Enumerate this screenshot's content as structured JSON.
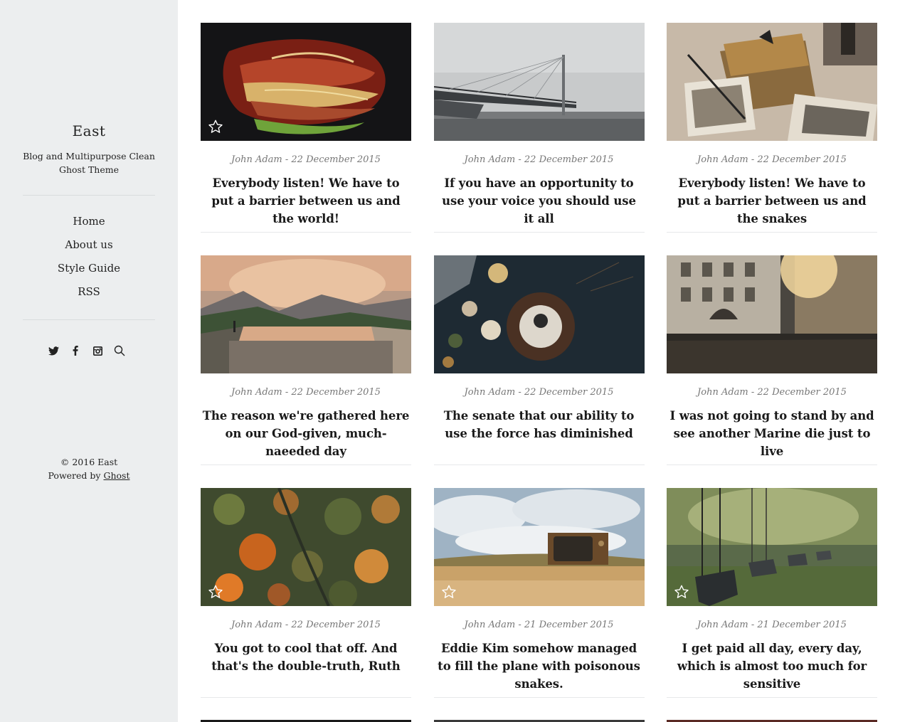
{
  "site": {
    "title": "East",
    "description": "Blog and Multipurpose Clean Ghost Theme"
  },
  "nav": [
    {
      "label": "Home"
    },
    {
      "label": "About us"
    },
    {
      "label": "Style Guide"
    },
    {
      "label": "RSS"
    }
  ],
  "social": [
    "twitter-icon",
    "facebook-icon",
    "instagram-icon",
    "search-icon"
  ],
  "footer": {
    "copyright": "© 2016 East",
    "powered_prefix": "Powered by",
    "powered_link": "Ghost"
  },
  "posts": [
    {
      "meta": "John Adam - 22 December 2015",
      "title": "Everybody listen! We have to put a barrier between us and the world!",
      "featured": true,
      "image": "autumn-leaves"
    },
    {
      "meta": "John Adam - 22 December 2015",
      "title": "If you have an opportunity to use your voice you should use it all",
      "featured": false,
      "image": "foggy-bridge"
    },
    {
      "meta": "John Adam - 22 December 2015",
      "title": "Everybody listen! We have to put a barrier between us and the snakes",
      "featured": false,
      "image": "old-letters"
    },
    {
      "meta": "John Adam - 22 December 2015",
      "title": "The reason we're gathered here on our God-given, much-naeeded day",
      "featured": false,
      "image": "mountain-lake"
    },
    {
      "meta": "John Adam - 22 December 2015",
      "title": "The senate that our ability to use the force has diminished",
      "featured": false,
      "image": "food-table"
    },
    {
      "meta": "John Adam - 22 December 2015",
      "title": "I was not going to stand by and see another Marine die just to live",
      "featured": false,
      "image": "city-street"
    },
    {
      "meta": "John Adam - 22 December 2015",
      "title": "You got to cool that off. And that's the double-truth, Ruth",
      "featured": true,
      "image": "forest-aerial"
    },
    {
      "meta": "John Adam - 21 December 2015",
      "title": "Eddie Kim somehow managed to fill the plane with poisonous snakes.",
      "featured": true,
      "image": "old-tv-field"
    },
    {
      "meta": "John Adam - 21 December 2015",
      "title": "I get paid all day, every day, which is almost too much for sensitive",
      "featured": true,
      "image": "swings"
    }
  ]
}
